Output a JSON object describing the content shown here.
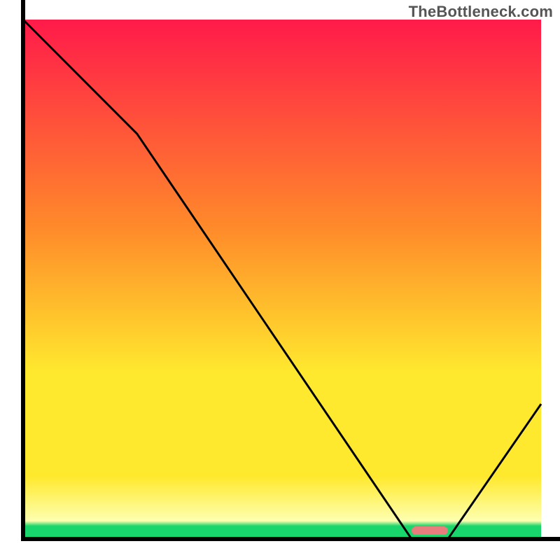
{
  "watermark": "TheBottleneck.com",
  "colors": {
    "top": "#ff1a4a",
    "mid_upper": "#ff8a2a",
    "mid": "#ffe92e",
    "pale_yellow": "#feffb0",
    "green": "#18d66b",
    "curve": "#000000",
    "bar": "#e97c7c",
    "axis": "#000000"
  },
  "chart_data": {
    "type": "line",
    "title": "",
    "xlabel": "",
    "ylabel": "",
    "xlim": [
      0,
      100
    ],
    "ylim": [
      0,
      100
    ],
    "x": [
      0,
      22,
      75,
      82,
      100
    ],
    "values": [
      100,
      78,
      0,
      0,
      26
    ],
    "optimal_range": {
      "start": 75,
      "end": 82
    }
  }
}
